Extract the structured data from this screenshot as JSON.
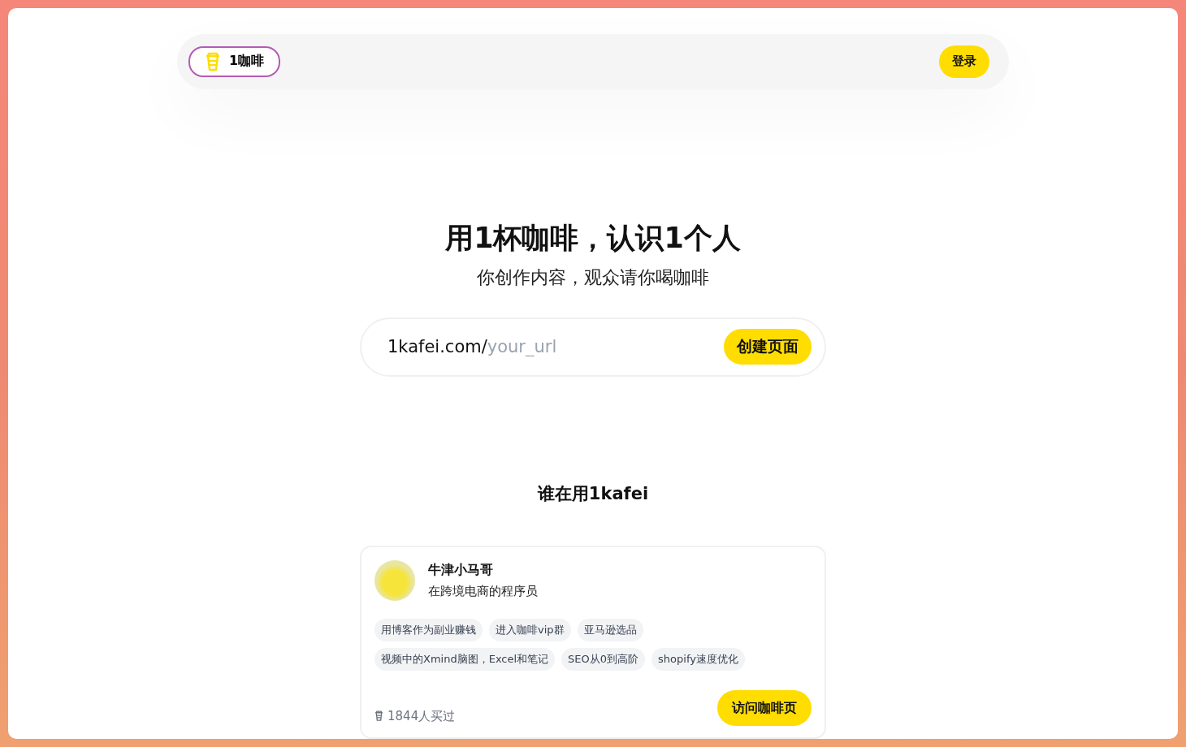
{
  "header": {
    "logo": "1咖啡",
    "login_button": "登录"
  },
  "hero": {
    "title": "用1杯咖啡，认识1个人",
    "subtitle": "你创作内容，观众请你喝咖啡"
  },
  "url_field": {
    "prefix": "1kafei.com/",
    "placeholder": "your_url",
    "button": "创建页面"
  },
  "showcase": {
    "heading": "谁在用1kafei",
    "cards": [
      {
        "name": "牛津小马哥",
        "bio": "在跨境电商的程序员",
        "tags": [
          "用博客作为副业赚钱",
          "进入咖啡vip群",
          "亚马逊选品",
          "视频中的Xmind脑图，Excel和笔记",
          "SEO从0到高阶",
          "shopify速度优化"
        ],
        "buyers": "1844人买过",
        "button": "访问咖啡页"
      }
    ]
  }
}
